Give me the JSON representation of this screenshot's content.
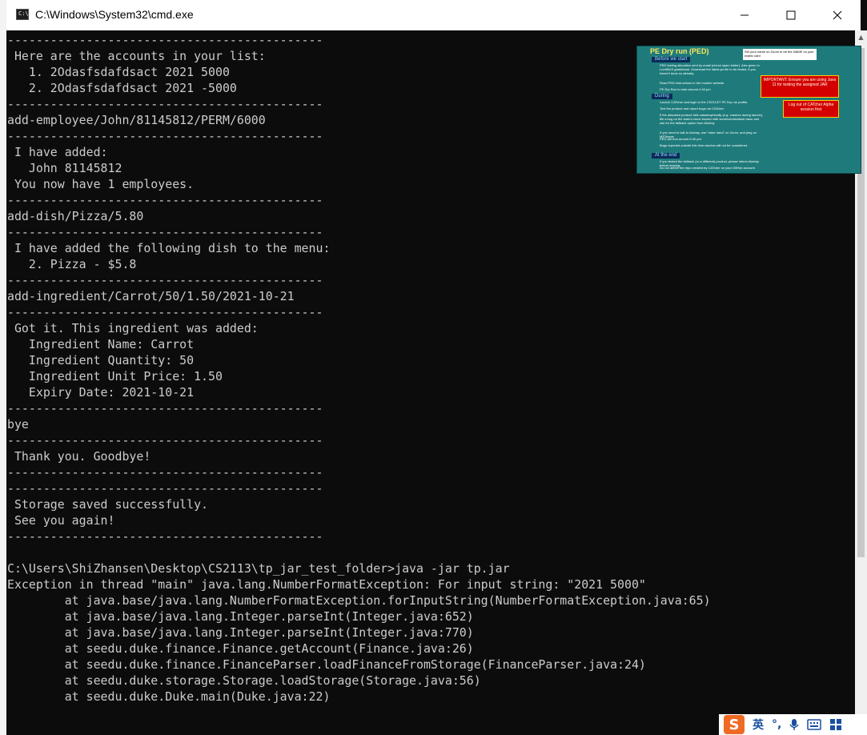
{
  "window": {
    "title": "C:\\Windows\\System32\\cmd.exe",
    "icon_label": "C:\\."
  },
  "console": {
    "lines": [
      "--------------------------------------------",
      " Here are the accounts in your list:",
      "   1. 2Odasfsdafdsact 2021 5000",
      "   2. 2Odasfsdafdsact 2021 -5000",
      "--------------------------------------------",
      "add-employee/John/81145812/PERM/6000",
      "--------------------------------------------",
      " I have added:",
      "   John 81145812",
      " You now have 1 employees.",
      "--------------------------------------------",
      "add-dish/Pizza/5.80",
      "--------------------------------------------",
      " I have added the following dish to the menu:",
      "   2. Pizza - $5.8",
      "--------------------------------------------",
      "add-ingredient/Carrot/50/1.50/2021-10-21",
      "--------------------------------------------",
      " Got it. This ingredient was added:",
      "   Ingredient Name: Carrot",
      "   Ingredient Quantity: 50",
      "   Ingredient Unit Price: 1.50",
      "   Expiry Date: 2021-10-21",
      "--------------------------------------------",
      "bye",
      "--------------------------------------------",
      " Thank you. Goodbye!",
      "--------------------------------------------",
      "--------------------------------------------",
      " Storage saved successfully.",
      " See you again!",
      "--------------------------------------------",
      "",
      "C:\\Users\\ShiZhansen\\Desktop\\CS2113\\tp_jar_test_folder>java -jar tp.jar",
      "Exception in thread \"main\" java.lang.NumberFormatException: For input string: \"2021 5000\"",
      "        at java.base/java.lang.NumberFormatException.forInputString(NumberFormatException.java:65)",
      "        at java.base/java.lang.Integer.parseInt(Integer.java:652)",
      "        at java.base/java.lang.Integer.parseInt(Integer.java:770)",
      "        at seedu.duke.finance.Finance.getAccount(Finance.java:26)",
      "        at seedu.duke.finance.FinanceParser.loadFinanceFromStorage(FinanceParser.java:24)",
      "        at seedu.duke.storage.Storage.loadStorage(Storage.java:56)",
      "        at seedu.duke.Duke.main(Duke.java:22)"
    ]
  },
  "overlay": {
    "title": "PE Dry run (PED)",
    "note": "Set your name on Zoom to be the NAME on your matric card",
    "sections": [
      "Before we start",
      "During",
      "At the end"
    ],
    "bullets_before": [
      "PED testing allocation sent by email (check spam folder). Also given in LumiNUS gradebook. Download the latest jar file to be tested, if you haven't done so already.",
      "Read PED instructions in the module website.",
      "PE Dry Run to start around 4:40 pm"
    ],
    "bullets_during": [
      "Launch CATcher and login to the CS2113/T PE Dry run profile.",
      "Test the product and report bugs via CATcher.",
      "If the allocated product fails catastrophically (e.g. crashes during launch), file a bug on the team's issue tracker with screenshots/stack trace and ask for the fallback option from Akshay",
      "If you need to talk to Akshay, use \"raise hand\" on Zoom, and ping on MSTeams",
      "PED will end around 5:40 pm.",
      "Bugs reported outside this time window will not be considered."
    ],
    "bullets_end": [
      "If you tested the fallback (or a different) product, please inform Akshay before leaving.",
      "Do not delete the repo created by CATcher on your GitHub account."
    ],
    "callout1": "IMPORTANT: Ensure you are using Java 11 for testing the assigned JAR",
    "callout2": "Log out of CATcher Alpha session first"
  },
  "tray": {
    "ime_label": "英",
    "punct_label": "°,"
  },
  "colors": {
    "console_bg": "#0c0c0c",
    "console_fg": "#cccccc",
    "overlay_bg": "#1f7b7b",
    "accent_yellow": "#ffe95c",
    "callout_red": "#d40000",
    "sogou_orange": "#ef6a24"
  }
}
